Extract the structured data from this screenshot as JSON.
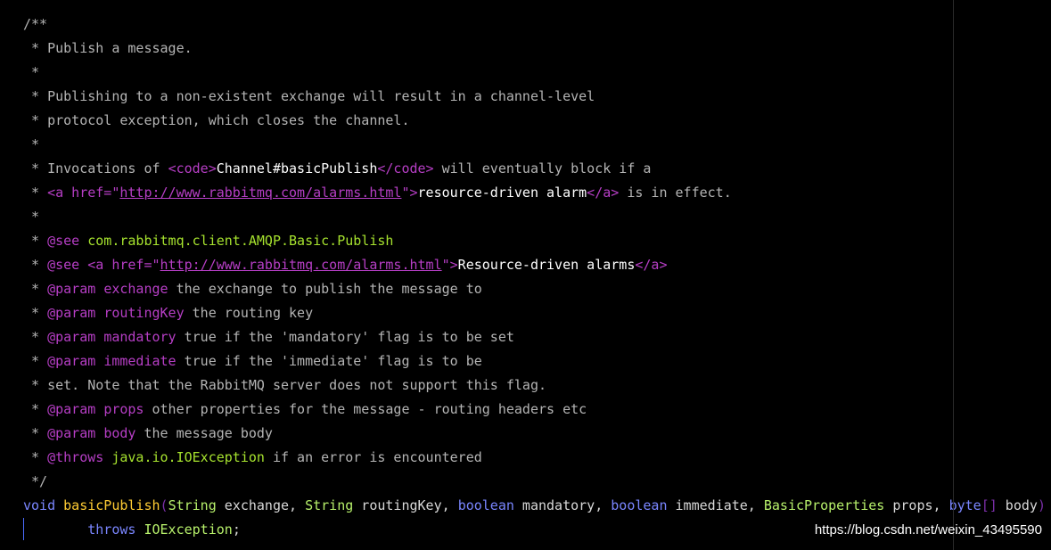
{
  "code": {
    "comment_open": "/**",
    "comment_star": " * ",
    "comment_star_only": " *",
    "comment_close": " */",
    "l2": "Publish a message.",
    "l4": "Publishing to a non-existent exchange will result in a channel-level",
    "l5": "protocol exception, which closes the channel.",
    "l7_a": "Invocations of ",
    "l7_tag_open": "<code>",
    "l7_b": "Channel#basicPublish",
    "l7_tag_close": "</code>",
    "l7_c": " will eventually block if a",
    "l8_tag_a": "<a href=\"",
    "l8_link": "http://www.rabbitmq.com/alarms.html",
    "l8_tag_b": "\">",
    "l8_text": "resource-driven alarm",
    "l8_tag_close": "</a>",
    "l8_tail": " is in effect.",
    "see_tag": "@see",
    "l10_ref": "com.rabbitmq.client.AMQP.Basic.Publish",
    "l11_tag_a": "<a href=\"",
    "l11_link": "http://www.rabbitmq.com/alarms.html",
    "l11_tag_b": "\">",
    "l11_text": "Resource-driven alarms",
    "l11_tag_close": "</a>",
    "param_tag": "@param",
    "l12_name": "exchange",
    "l12_desc": " the exchange to publish the message to",
    "l13_name": "routingKey",
    "l13_desc": " the routing key",
    "l14_name": "mandatory",
    "l14_desc": " true if the 'mandatory' flag is to be set",
    "l15_name": "immediate",
    "l15_desc": " true if the 'immediate' flag is to be",
    "l16": "set. Note that the RabbitMQ server does not support this flag.",
    "l17_name": "props",
    "l17_desc": " other properties for the message - routing headers etc",
    "l18_name": "body",
    "l18_desc": " the message body",
    "throws_tag": "@throws",
    "l19_ref": "java.io.IOException",
    "l19_desc": " if an error is encountered",
    "sig_void": "void",
    "sig_method": "basicPublish",
    "sig_paren_open": "(",
    "sig_string1": "String",
    "sig_exchange": " exchange, ",
    "sig_string2": "String",
    "sig_routingkey": " routingKey, ",
    "sig_boolean1": "boolean",
    "sig_mandatory": " mandatory, ",
    "sig_boolean2": "boolean",
    "sig_immediate": " immediate, ",
    "sig_basicprops": "BasicProperties",
    "sig_props": " props, ",
    "sig_byte": "byte",
    "sig_brackets": "[]",
    "sig_body": " body",
    "sig_paren_close": ")",
    "l22_indent": "        ",
    "l22_throws": "throws",
    "l22_sp": " ",
    "l22_exc": "IOException",
    "l22_semi": ";"
  },
  "watermark": "https://blog.csdn.net/weixin_43495590",
  "colors": {
    "background": "#000000",
    "comment": "#b4b4b4",
    "tag": "#b63ec5",
    "keyword": "#7a86ff",
    "method": "#ffcc33",
    "type": "#b7f06b"
  }
}
